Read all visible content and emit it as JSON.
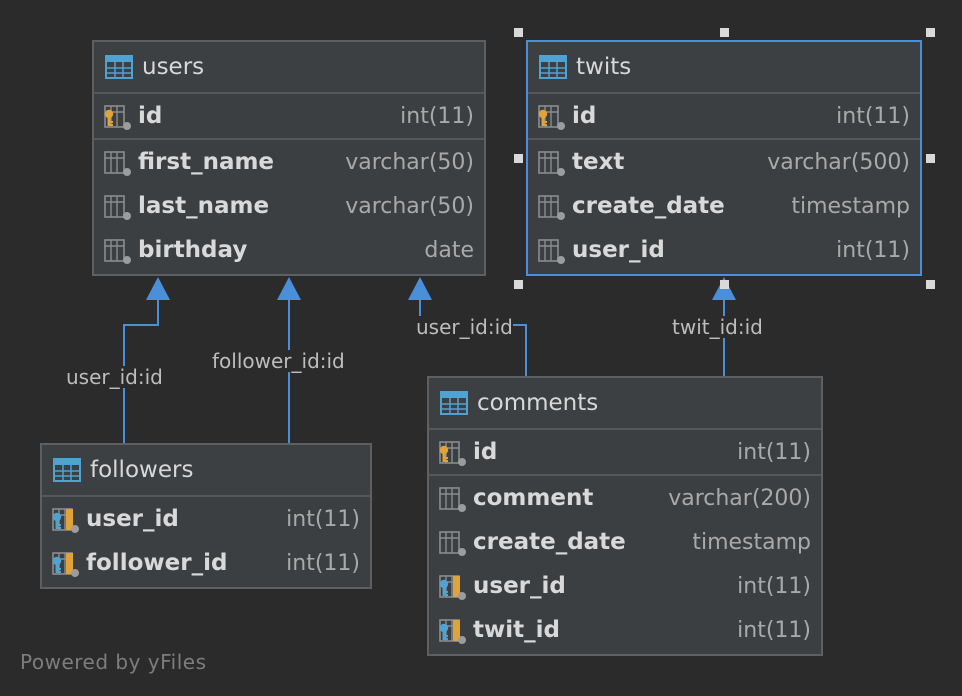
{
  "tables": {
    "users": {
      "title": "users",
      "pk": [
        {
          "name": "id",
          "type": "int(11)",
          "icon": "primary-key-icon"
        }
      ],
      "columns": [
        {
          "name": "first_name",
          "type": "varchar(50)",
          "icon": "column-icon"
        },
        {
          "name": "last_name",
          "type": "varchar(50)",
          "icon": "column-icon"
        },
        {
          "name": "birthday",
          "type": "date",
          "icon": "column-icon"
        }
      ]
    },
    "twits": {
      "title": "twits",
      "pk": [
        {
          "name": "id",
          "type": "int(11)",
          "icon": "primary-key-icon"
        }
      ],
      "columns": [
        {
          "name": "text",
          "type": "varchar(500)",
          "icon": "column-icon"
        },
        {
          "name": "create_date",
          "type": "timestamp",
          "icon": "column-icon"
        },
        {
          "name": "user_id",
          "type": "int(11)",
          "icon": "column-icon"
        }
      ]
    },
    "followers": {
      "title": "followers",
      "pk": [
        {
          "name": "user_id",
          "type": "int(11)",
          "icon": "primary-foreign-key-icon"
        },
        {
          "name": "follower_id",
          "type": "int(11)",
          "icon": "primary-foreign-key-icon"
        }
      ],
      "columns": []
    },
    "comments": {
      "title": "comments",
      "pk": [
        {
          "name": "id",
          "type": "int(11)",
          "icon": "primary-key-icon"
        }
      ],
      "columns": [
        {
          "name": "comment",
          "type": "varchar(200)",
          "icon": "column-icon"
        },
        {
          "name": "create_date",
          "type": "timestamp",
          "icon": "column-icon"
        },
        {
          "name": "user_id",
          "type": "int(11)",
          "icon": "foreign-key-icon"
        },
        {
          "name": "twit_id",
          "type": "int(11)",
          "icon": "foreign-key-icon"
        }
      ]
    }
  },
  "relations": [
    {
      "label": "user_id:id",
      "from": "followers",
      "to": "users"
    },
    {
      "label": "follower_id:id",
      "from": "followers",
      "to": "users"
    },
    {
      "label": "user_id:id",
      "from": "comments",
      "to": "users"
    },
    {
      "label": "twit_id:id",
      "from": "comments",
      "to": "twits"
    }
  ],
  "colors": {
    "background": "#2b2b2b",
    "edge": "#4a8fd9",
    "selection": "#4a8fd9",
    "key": "#e0a33a",
    "foreign_key": "#4fa3d1"
  },
  "footer": "Powered by yFiles"
}
